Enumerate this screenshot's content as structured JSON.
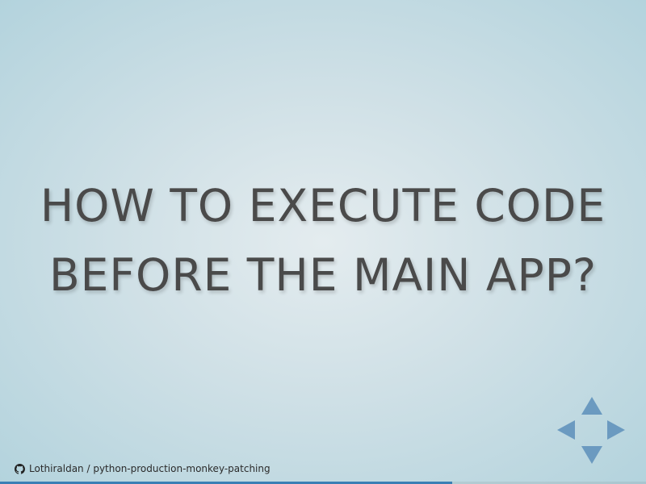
{
  "slide": {
    "title_line1": "HOW TO EXECUTE CODE",
    "title_line2": "BEFORE THE MAIN APP?"
  },
  "footer": {
    "repo_link_text": "Lothiraldan / python-production-monkey-patching",
    "icon": "github-icon"
  },
  "progress": {
    "fraction": 0.7
  },
  "controls": {
    "up": "arrow-up-icon",
    "down": "arrow-down-icon",
    "left": "arrow-left-icon",
    "right": "arrow-right-icon",
    "color": "#6b9ac0"
  },
  "colors": {
    "text": "#4a4a4a",
    "progress": "#3a7fb5"
  }
}
